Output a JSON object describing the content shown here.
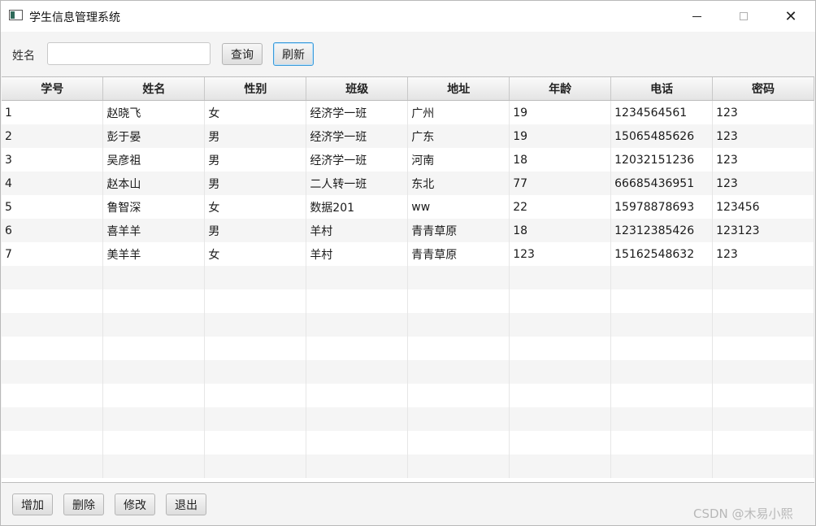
{
  "window": {
    "title": "学生信息管理系统",
    "controls": {
      "minimize": "",
      "maximize": "",
      "close": "✕"
    }
  },
  "search": {
    "label": "姓名",
    "value": "",
    "placeholder": "",
    "query_label": "查询",
    "refresh_label": "刷新"
  },
  "table": {
    "columns": [
      "学号",
      "姓名",
      "性别",
      "班级",
      "地址",
      "年龄",
      "电话",
      "密码"
    ],
    "rows": [
      [
        "1",
        "赵晓飞",
        "女",
        "经济学一班",
        "广州",
        "19",
        "1234564561",
        "123"
      ],
      [
        "2",
        "彭于晏",
        "男",
        "经济学一班",
        "广东",
        "19",
        "15065485626",
        "123"
      ],
      [
        "3",
        "吴彦祖",
        "男",
        "经济学一班",
        "河南",
        "18",
        "12032151236",
        "123"
      ],
      [
        "4",
        "赵本山",
        "男",
        "二人转一班",
        "东北",
        "77",
        "66685436951",
        "123"
      ],
      [
        "5",
        "鲁智深",
        "女",
        "数据201",
        "ww",
        "22",
        "15978878693",
        "123456"
      ],
      [
        "6",
        "喜羊羊",
        "男",
        "羊村",
        "青青草原",
        "18",
        "12312385426",
        "123123"
      ],
      [
        "7",
        "美羊羊",
        "女",
        "羊村",
        "青青草原",
        "123",
        "15162548632",
        "123"
      ]
    ]
  },
  "actions": {
    "add_label": "增加",
    "delete_label": "删除",
    "edit_label": "修改",
    "exit_label": "退出"
  },
  "watermark": "CSDN @木易小熙"
}
